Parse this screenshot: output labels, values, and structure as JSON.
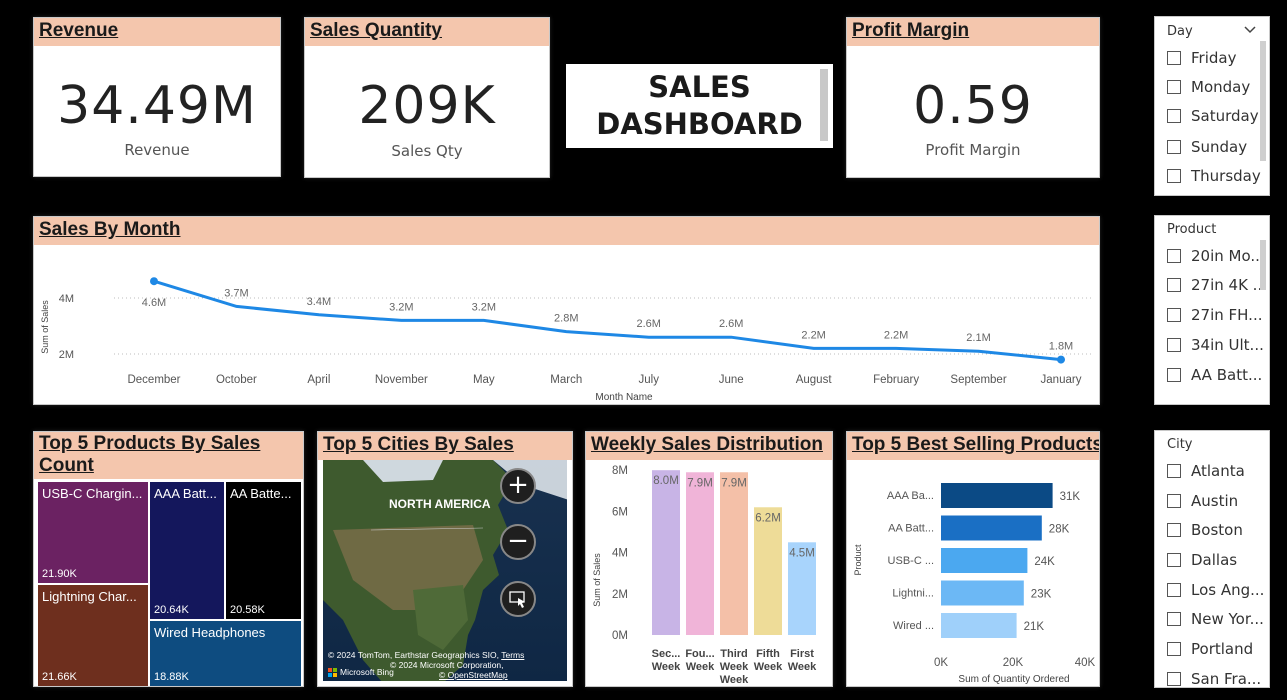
{
  "kpis": {
    "revenue": {
      "title": "Revenue",
      "value": "34.49M",
      "label": "Revenue"
    },
    "sales_qty": {
      "title": "Sales Quantity",
      "value": "209K",
      "label": "Sales Qty"
    },
    "profit_margin": {
      "title": "Profit Margin",
      "value": "0.59",
      "label": "Profit Margin"
    }
  },
  "dashboard_title": {
    "line1": "SALES",
    "line2": "DASHBOARD"
  },
  "slicers": {
    "day": {
      "header": "Day",
      "items": [
        "Friday",
        "Monday",
        "Saturday",
        "Sunday",
        "Thursday"
      ]
    },
    "product": {
      "header": "Product",
      "items": [
        "20in Mo...",
        "27in 4K ...",
        "27in FH...",
        "34in Ult...",
        "AA Batt..."
      ]
    },
    "city": {
      "header": "City",
      "items": [
        "Atlanta",
        "Austin",
        "Boston",
        "Dallas",
        "Los Ang...",
        "New Yor...",
        "Portland",
        "San Fra..."
      ]
    }
  },
  "treemap": {
    "title_line1": "Top 5 Products By Sales",
    "title_line2": "Count",
    "cells": [
      {
        "name": "USB-C Chargin...",
        "value": "21.90K",
        "color": "#6b2262"
      },
      {
        "name": "Lightning Char...",
        "value": "21.66K",
        "color": "#6e2f1e"
      },
      {
        "name": "AAA Batt...",
        "value": "20.64K",
        "color": "#14175c"
      },
      {
        "name": "AA Batte...",
        "value": "20.58K",
        "color": "#000000"
      },
      {
        "name": "Wired Headphones",
        "value": "18.88K",
        "color": "#0e4c80"
      }
    ]
  },
  "map": {
    "title": "Top 5 Cities By Sales",
    "region_label": "NORTH AMERICA",
    "credit1": "© 2024 TomTom, Earthstar Geographics SIO,",
    "terms": "Terms",
    "credit2": "© 2024 Microsoft Corporation,",
    "credit3": "© OpenStreetMap",
    "bing": "Microsoft Bing"
  },
  "line_chart_title": "Sales By Month",
  "weekly_title": "Weekly Sales Distribution",
  "best_title": "Top 5 Best Selling Products",
  "chart_data": [
    {
      "type": "line",
      "title": "Sales By Month",
      "xlabel": "Month Name",
      "ylabel": "Sum of Sales",
      "categories": [
        "December",
        "October",
        "April",
        "November",
        "May",
        "March",
        "July",
        "June",
        "August",
        "February",
        "September",
        "January"
      ],
      "values": [
        4.6,
        3.7,
        3.4,
        3.2,
        3.2,
        2.8,
        2.6,
        2.6,
        2.2,
        2.2,
        2.1,
        1.8
      ],
      "labels": [
        "4.6M",
        "3.7M",
        "3.4M",
        "3.2M",
        "3.2M",
        "2.8M",
        "2.6M",
        "2.6M",
        "2.2M",
        "2.2M",
        "2.1M",
        "1.8M"
      ],
      "y_ticks": [
        "2M",
        "4M"
      ],
      "grid": true,
      "color": "#1e88e5"
    },
    {
      "type": "bar",
      "title": "Weekly Sales Distribution",
      "ylabel": "Sum of Sales",
      "categories": [
        [
          "Sec...",
          "Week"
        ],
        [
          "Fou...",
          "Week"
        ],
        [
          "Third",
          "Week",
          "Week"
        ],
        [
          "Fifth",
          "Week"
        ],
        [
          "First",
          "Week"
        ]
      ],
      "values": [
        8.0,
        7.9,
        7.9,
        6.2,
        4.5
      ],
      "labels": [
        "8.0M",
        "7.9M",
        "7.9M",
        "6.2M",
        "4.5M"
      ],
      "colors": [
        "#c8b4e6",
        "#f0b4d8",
        "#f4c0a8",
        "#eedc98",
        "#a8d4fc"
      ],
      "y_ticks": [
        "0M",
        "2M",
        "4M",
        "6M",
        "8M"
      ],
      "ylim": [
        0,
        8
      ]
    },
    {
      "type": "bar",
      "orientation": "horizontal",
      "title": "Top 5 Best Selling Products",
      "xlabel": "Sum of Quantity Ordered",
      "ylabel": "Product",
      "categories": [
        "AAA Ba...",
        "AA Batt...",
        "USB-C ...",
        "Lightni...",
        "Wired ..."
      ],
      "values": [
        31,
        28,
        24,
        23,
        21
      ],
      "labels": [
        "31K",
        "28K",
        "24K",
        "23K",
        "21K"
      ],
      "colors": [
        "#0b4a85",
        "#1a6fc4",
        "#4ba8f0",
        "#6cb8f5",
        "#9fd0fa"
      ],
      "x_ticks": [
        "0K",
        "20K",
        "40K"
      ],
      "xlim": [
        0,
        40
      ]
    }
  ]
}
